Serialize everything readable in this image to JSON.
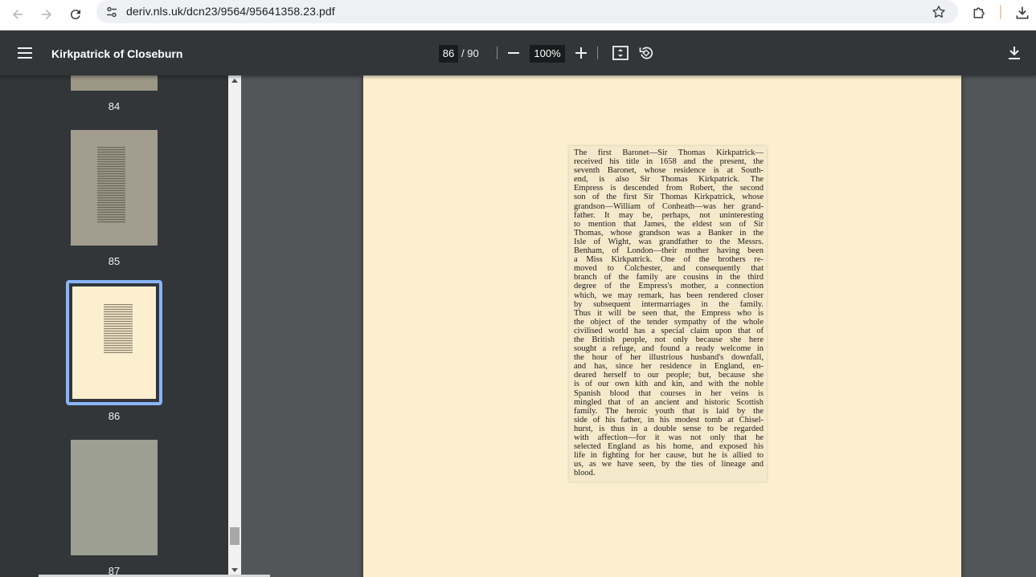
{
  "browser": {
    "url": "deriv.nls.uk/dcn23/9564/95641358.23.pdf",
    "back_icon": "arrow-left-icon",
    "forward_icon": "arrow-right-icon",
    "reload_icon": "reload-icon",
    "site_info_icon": "tune-icon",
    "bookmark_icon": "star-icon",
    "extensions_icon": "puzzle-icon",
    "downloads_icon": "download-icon"
  },
  "toolbar": {
    "title": "Kirkpatrick of Closeburn",
    "page_current": "86",
    "page_total": "/ 90",
    "zoom": "100%",
    "menu_icon": "hamburger-menu-icon",
    "zoom_out_icon": "minus-icon",
    "zoom_in_icon": "plus-icon",
    "fit_icon": "fit-to-page-icon",
    "rotate_icon": "rotate-counterclockwise-icon",
    "download_icon": "download-icon"
  },
  "sidebar": {
    "thumbnails": [
      {
        "label": "84"
      },
      {
        "label": "85"
      },
      {
        "label": "86",
        "selected": true
      },
      {
        "label": "87"
      }
    ],
    "selected_color": "#8ab4f8"
  },
  "document": {
    "lines": [
      "The first Baronet—Sir Thomas Kirkpatrick—",
      "received his title in 1658 and the present, the",
      "seventh Baronet, whose residence is at South-",
      "end, is also Sir Thomas Kirkpatrick. The",
      "Empress is descended from Robert, the second",
      "son of the first Sir Thomas Kirkpatrick, whose",
      "grandson—William of Conheath—was her grand-",
      "father. It may be, perhaps, not uninteresting",
      "to mention that James, the eldest son of Sir",
      "Thomas, whose grandson was a Banker in the",
      "Isle of Wight, was grandfather to the Messrs.",
      "Benham, of London—their mother having been",
      "a Miss Kirkpatrick. One of the brothers re-",
      "moved to Colchester, and consequently that",
      "branch of the family are cousins in the third",
      "degree of the Empress's mother, a connection",
      "which, we may remark, has been rendered closer",
      "by subsequent intermarriages in the family.",
      "Thus it will be seen that, the Empress who is",
      "the object of the tender sympathy of the whole",
      "civilised world has a special claim upon that of",
      "the British people, not only because she here",
      "sought a refuge, and found a ready welcome in",
      "the hour of her illustrious husband's downfall,",
      "and has, since her residence in England, en-",
      "deared herself to our people; but, because she",
      "is of our own kith and kin, and with the noble",
      "Spanish blood that courses in her veins is",
      "mingled that of an ancient and historic Scottish",
      "family. The heroic youth that is laid by the",
      "side of his father, in his modest tomb at Chisel-",
      "hurst, is thus in a double sense to be regarded",
      "with affection—for it was not only that he",
      "selected England as his home, and exposed his",
      "life in fighting for her cause, but he is allied to",
      "us, as we have seen, by the ties of lineage and",
      "blood."
    ],
    "page_color": "#fcefd0"
  }
}
